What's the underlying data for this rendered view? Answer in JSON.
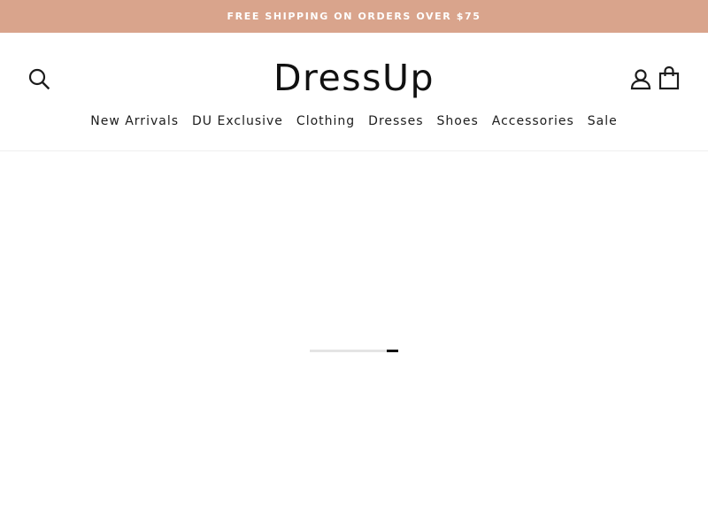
{
  "colors": {
    "announcement_bg": "#d9a48c",
    "text": "#1c1c1c",
    "loader_fill": "#111111",
    "loader_track": "#e4e4e4"
  },
  "announcement": {
    "text": "FREE SHIPPING ON ORDERS OVER $75"
  },
  "header": {
    "logo_text": "DressUp",
    "icons": {
      "search": "search-icon",
      "account": "user-icon",
      "cart": "shopping-bag-icon"
    }
  },
  "nav": {
    "items": [
      {
        "label": "New Arrivals"
      },
      {
        "label": "DU Exclusive"
      },
      {
        "label": "Clothing"
      },
      {
        "label": "Dresses"
      },
      {
        "label": "Shoes"
      },
      {
        "label": "Accessories"
      },
      {
        "label": "Sale"
      }
    ]
  },
  "loader": {
    "progress_start": 0.87,
    "progress_end": 1.0
  }
}
